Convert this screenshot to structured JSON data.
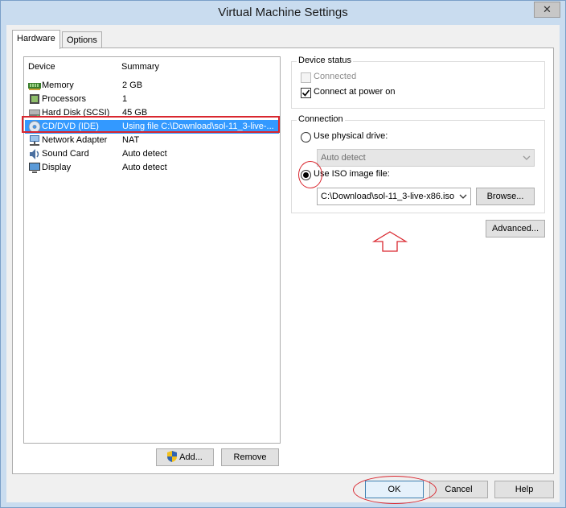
{
  "window": {
    "title": "Virtual Machine Settings",
    "close_glyph": "✕"
  },
  "tabs": [
    {
      "label": "Hardware"
    },
    {
      "label": "Options"
    }
  ],
  "device_list": {
    "columns": {
      "device": "Device",
      "summary": "Summary"
    },
    "rows": [
      {
        "name": "Memory",
        "summary": "2 GB",
        "icon": "memory-icon"
      },
      {
        "name": "Processors",
        "summary": "1",
        "icon": "processor-icon"
      },
      {
        "name": "Hard Disk (SCSI)",
        "summary": "45 GB",
        "icon": "hard-disk-icon"
      },
      {
        "name": "CD/DVD (IDE)",
        "summary": "Using file C:\\Download\\sol-11_3-live-...",
        "icon": "cd-dvd-icon",
        "selected": true
      },
      {
        "name": "Network Adapter",
        "summary": "NAT",
        "icon": "network-adapter-icon"
      },
      {
        "name": "Sound Card",
        "summary": "Auto detect",
        "icon": "sound-card-icon"
      },
      {
        "name": "Display",
        "summary": "Auto detect",
        "icon": "display-icon"
      }
    ]
  },
  "list_buttons": {
    "add": "Add...",
    "remove": "Remove"
  },
  "device_status": {
    "title": "Device status",
    "connected": {
      "label": "Connected",
      "checked": false,
      "enabled": false
    },
    "connect_at_power_on": {
      "label": "Connect at power on",
      "checked": true
    }
  },
  "connection": {
    "title": "Connection",
    "physical_drive": {
      "label": "Use physical drive:",
      "selected": false
    },
    "physical_drive_value": "Auto detect",
    "iso_image": {
      "label": "Use ISO image file:",
      "selected": true
    },
    "iso_path": "C:\\Download\\sol-11_3-live-x86.iso",
    "browse": "Browse..."
  },
  "advanced_button": "Advanced...",
  "footer": {
    "ok": "OK",
    "cancel": "Cancel",
    "help": "Help"
  },
  "colors": {
    "selection": "#3399ff",
    "annotation": "#d9262e",
    "window_frame": "#c9dcef"
  }
}
